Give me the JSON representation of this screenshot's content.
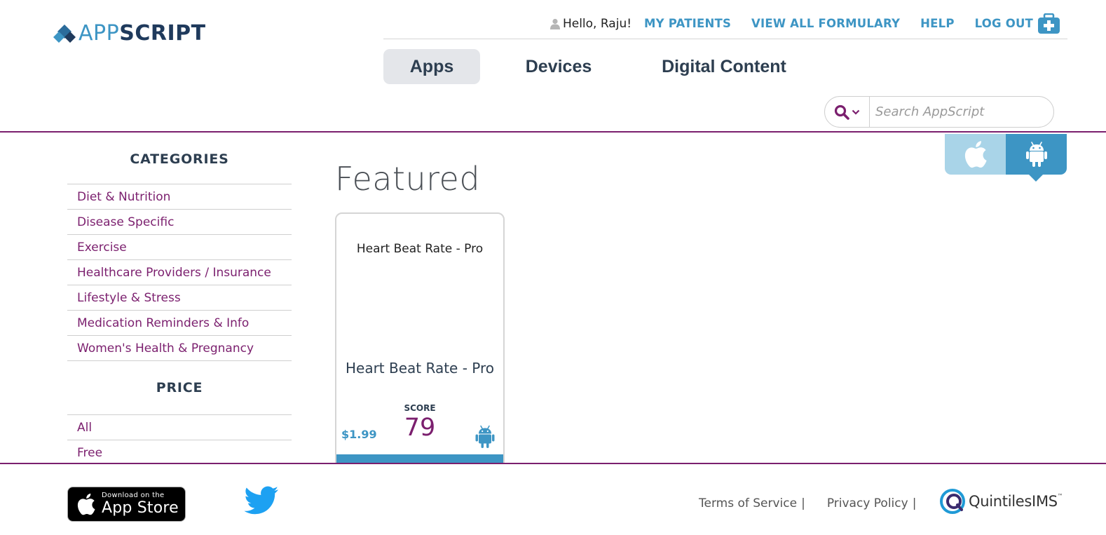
{
  "brand": {
    "logo_app": "APP",
    "logo_script": "SCRIPT"
  },
  "topnav": {
    "greeting": "Hello, Raju!",
    "links": [
      "MY PATIENTS",
      "VIEW ALL FORMULARY",
      "HELP",
      "LOG OUT"
    ],
    "icons": {
      "user": "user-icon",
      "medkit": "medkit-icon"
    }
  },
  "tabs": [
    "Apps",
    "Devices",
    "Digital Content"
  ],
  "search": {
    "placeholder": "Search AppScript",
    "icon": "search-icon"
  },
  "sidebar": {
    "categories_heading": "CATEGORIES",
    "categories": [
      "Diet & Nutrition",
      "Disease Specific",
      "Exercise",
      "Healthcare Providers / Insurance",
      "Lifestyle & Stress",
      "Medication Reminders & Info",
      "Women's Health & Pregnancy"
    ],
    "price_heading": "PRICE",
    "prices": [
      "All",
      "Free"
    ]
  },
  "main": {
    "title": "Featured",
    "platform_toggle": {
      "options": [
        "apple-icon",
        "android-icon"
      ],
      "selected": "android"
    },
    "card": {
      "title_top": "Heart Beat Rate - Pro",
      "name": "Heart Beat Rate - Pro",
      "score_label": "SCORE",
      "score": "79",
      "price": "$1.99",
      "platform": "android-icon"
    }
  },
  "footer": {
    "appstore_small": "Download on the",
    "appstore_big": "App Store",
    "links": [
      "Terms of Service",
      "Privacy Policy"
    ],
    "separator": "|",
    "partner": "QuintilesIMS",
    "partner_tm": "™"
  },
  "colors": {
    "purple": "#7b1f6e",
    "blue": "#3d95c4",
    "navy": "#2d3e50",
    "light_blue": "#a9d4e8"
  }
}
